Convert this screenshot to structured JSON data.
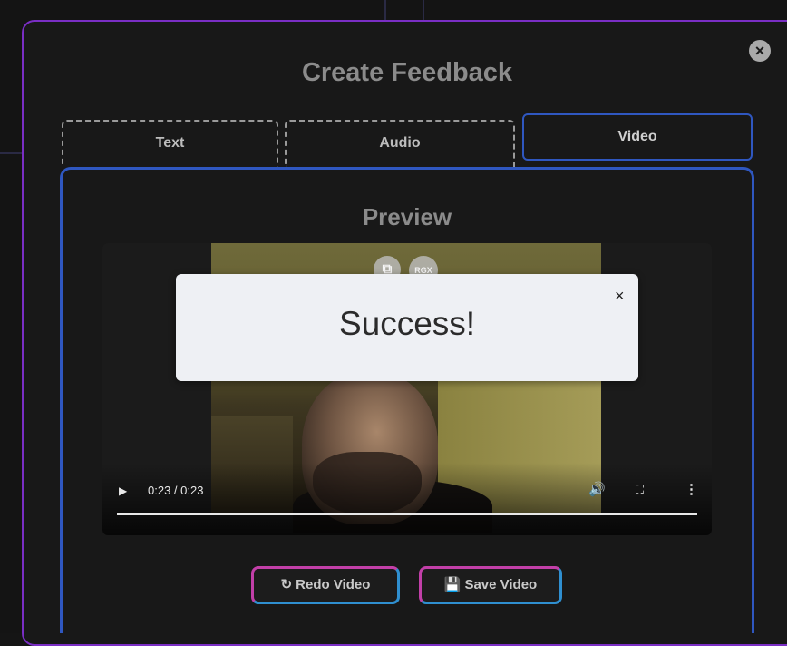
{
  "modal": {
    "title": "Create Feedback",
    "close_icon": "×"
  },
  "tabs": [
    {
      "label": "Text"
    },
    {
      "label": "Audio"
    },
    {
      "label": "Video",
      "active": true
    }
  ],
  "preview": {
    "title": "Preview"
  },
  "player": {
    "play_icon": "▶",
    "time": "0:23 / 0:23",
    "progress": 1.0,
    "volume_icon": "🔊",
    "fullscreen_icon": "⛶",
    "more_icon": "⋮"
  },
  "overlay_icons": {
    "external_link_icon": "⧉",
    "rgx_label": "RGX"
  },
  "toast": {
    "message": "Success!",
    "close_icon": "×"
  },
  "actions": {
    "redo_icon": "↻",
    "redo_label": "Redo Video",
    "save_icon": "💾",
    "save_label": "Save Video"
  },
  "colors": {
    "modal_border": "#7a2ec4",
    "panel_border": "#2f57c0",
    "toast_bg": "#eef0f4"
  }
}
